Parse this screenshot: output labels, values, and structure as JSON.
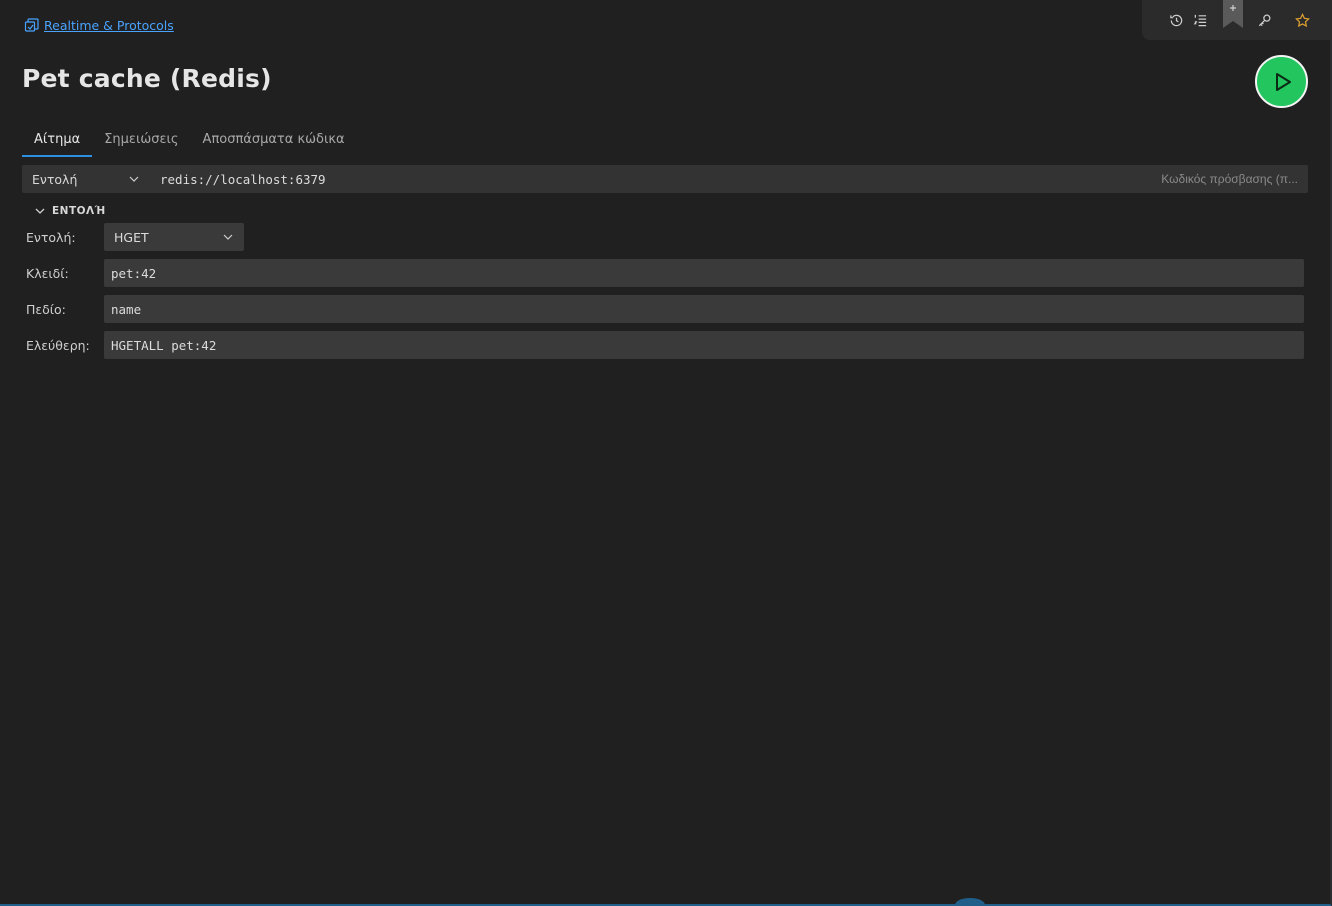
{
  "breadcrumb": {
    "label": "Realtime & Protocols"
  },
  "title": "Pet cache (Redis)",
  "tabs": [
    {
      "label": "Αίτημα",
      "active": true
    },
    {
      "label": "Σημειώσεις",
      "active": false
    },
    {
      "label": "Αποσπάσματα κώδικα",
      "active": false
    }
  ],
  "url_bar": {
    "method": "Εντολή",
    "url": "redis://localhost:6379",
    "password_placeholder": "Κωδικός πρόσβασης (π..."
  },
  "section": {
    "title": "ΕΝΤΟΛΉ"
  },
  "form": {
    "command_label": "Εντολή:",
    "command_value": "HGET",
    "key_label": "Κλειδί:",
    "key_value": "pet:42",
    "field_label": "Πεδίο:",
    "field_value": "name",
    "free_label": "Ελεύθερη:",
    "free_value": "HGETALL pet:42"
  },
  "toolbar": {
    "icons": [
      "history-icon",
      "list-icon",
      "bookmark-icon",
      "key-icon",
      "star-icon"
    ]
  },
  "colors": {
    "accent": "#2f8fe0",
    "link": "#4aa3ff",
    "run_button": "#22c55e",
    "star": "#e0a030"
  }
}
